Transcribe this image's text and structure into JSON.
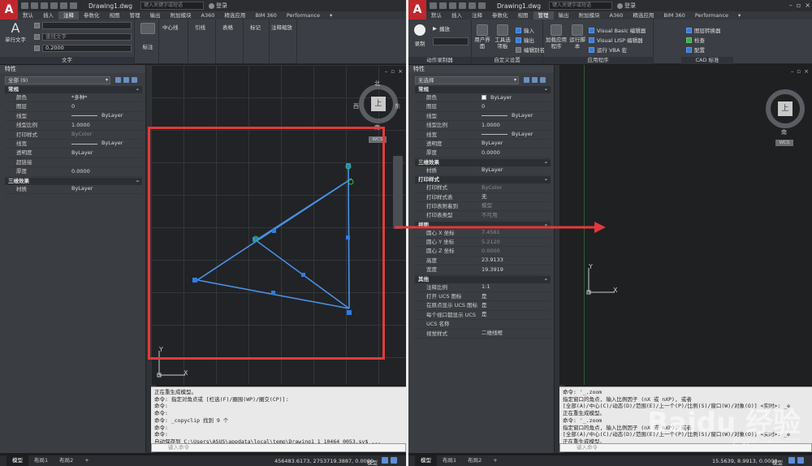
{
  "left": {
    "doc_title": "Drawing1.dwg",
    "search_placeholder": "键入关键字或短语",
    "login": "登录",
    "tabs": [
      "默认",
      "插入",
      "注释",
      "参数化",
      "视图",
      "管理",
      "输出",
      "附加模块",
      "A360",
      "精选应用",
      "BIM 360",
      "Performance"
    ],
    "active_tab": "注释",
    "ribbon": {
      "text_btn": "单行文字",
      "text_style_value": "",
      "text_find_placeholder": "查找文字",
      "text_height": "0.2000",
      "group_text": "文字",
      "dim_btn": "标注",
      "centerline": "中心线",
      "leader": "引线",
      "table": "表格",
      "markup": "标记",
      "anno_scale": "注释缩放"
    },
    "props": {
      "title": "特性",
      "selector": "全部 (9)",
      "sec_general": "常规",
      "rows": [
        {
          "k": "颜色",
          "v": "*多种*"
        },
        {
          "k": "图层",
          "v": "0"
        },
        {
          "k": "线型",
          "v": "ByLayer"
        },
        {
          "k": "线型比例",
          "v": "1.0000"
        },
        {
          "k": "打印样式",
          "v": "ByColor"
        },
        {
          "k": "线宽",
          "v": "ByLayer"
        },
        {
          "k": "透明度",
          "v": "ByLayer"
        },
        {
          "k": "超链接",
          "v": ""
        },
        {
          "k": "厚度",
          "v": "0.0000"
        }
      ],
      "sec_3d": "三维效果",
      "rows3d": [
        {
          "k": "材质",
          "v": "ByLayer"
        }
      ]
    },
    "viewcube": {
      "n": "北",
      "s": "南",
      "e": "东",
      "w": "西",
      "top": "上",
      "wcs": "WCS"
    },
    "ucs": {
      "x": "X",
      "y": "Y"
    },
    "cmd_lines": [
      "正在重生成模型。",
      "命令: 指定对角点或 [栏选(F)/圈围(WP)/圈交(CP)]:",
      "命令:",
      "命令:",
      "命令: _copyclip 找到 9 个",
      "命令:",
      "命令:",
      "自动保存到 C:\\Users\\ASUS\\appdata\\local\\temp\\Drawing1_1_10464_0053.sv$ ...",
      "命令:"
    ],
    "cmd_placeholder": "键入命令",
    "status_tabs": [
      "模型",
      "布局1",
      "布局2"
    ],
    "coords": "456483.6173, 2753719.3887, 0.0000",
    "model_label": "模型"
  },
  "right": {
    "doc_title": "Drawing1.dwg",
    "search_placeholder": "键入关键字或短语",
    "login": "登录",
    "tabs": [
      "默认",
      "插入",
      "注释",
      "参数化",
      "视图",
      "管理",
      "输出",
      "附加模块",
      "A360",
      "精选应用",
      "BIM 360",
      "Performance"
    ],
    "active_tab": "管理",
    "ribbon": {
      "record": "录制",
      "play": "播放",
      "group_action": "动作录制器",
      "user_interface": "用户界面",
      "tool_palettes": "工具选项板",
      "import": "输入",
      "export": "输出",
      "edit_alias": "编辑别名",
      "group_custom": "自定义设置",
      "load_app": "加载应用程序",
      "run_script": "运行脚本",
      "vb_editor": "Visual Basic 编辑器",
      "vlisp_editor": "Visual LISP 编辑器",
      "run_vba": "运行 VBA 宏",
      "group_app": "应用程序",
      "layer_translator": "图层转换器",
      "check": "检查",
      "configure": "配置",
      "group_cad": "CAD 标准"
    },
    "props": {
      "title": "特性",
      "selector": "无选择",
      "sec_general": "常规",
      "rows": [
        {
          "k": "颜色",
          "v": "ByLayer"
        },
        {
          "k": "图层",
          "v": "0"
        },
        {
          "k": "线型",
          "v": "ByLayer"
        },
        {
          "k": "线型比例",
          "v": "1.0000"
        },
        {
          "k": "线宽",
          "v": "ByLayer"
        },
        {
          "k": "透明度",
          "v": "ByLayer"
        },
        {
          "k": "厚度",
          "v": "0.0000"
        }
      ],
      "sec_3d": "三维效果",
      "rows3d": [
        {
          "k": "材质",
          "v": "ByLayer"
        }
      ],
      "sec_plot": "打印样式",
      "rows_plot": [
        {
          "k": "打印样式",
          "v": "ByColor"
        },
        {
          "k": "打印样式表",
          "v": "无"
        },
        {
          "k": "打印表附着到",
          "v": "模型"
        },
        {
          "k": "打印表类型",
          "v": "不可用"
        }
      ],
      "sec_view": "视图",
      "rows_view": [
        {
          "k": "圆心 X 坐标",
          "v": "7.4561"
        },
        {
          "k": "圆心 Y 坐标",
          "v": "5.2120"
        },
        {
          "k": "圆心 Z 坐标",
          "v": "0.0000"
        },
        {
          "k": "高度",
          "v": "23.9133"
        },
        {
          "k": "宽度",
          "v": "19.3919"
        }
      ],
      "sec_misc": "其他",
      "rows_misc": [
        {
          "k": "注释比例",
          "v": "1:1"
        },
        {
          "k": "打开 UCS 图标",
          "v": "是"
        },
        {
          "k": "在原点显示 UCS 图标",
          "v": "是"
        },
        {
          "k": "每个视口都显示 UCS",
          "v": "是"
        },
        {
          "k": "UCS 名称",
          "v": ""
        },
        {
          "k": "视觉样式",
          "v": "二维线框"
        }
      ]
    },
    "viewcube": {
      "s": "南",
      "top": "上",
      "wcs": "WCS"
    },
    "ucs": {
      "x": "X",
      "y": "Y"
    },
    "cmd_lines": [
      "命令: '_.zoom",
      "指定窗口的角点, 输入比例因子 (nX 或 nXP), 或者",
      "[全部(A)/中心(C)/动态(D)/范围(E)/上一个(P)/比例(S)/窗口(W)/对象(O)] <实时>: _e",
      "正在重生成模型。",
      "命令: '_.zoom",
      "指定窗口的角点, 输入比例因子 (nX 或 nXP), 或者",
      "[全部(A)/中心(C)/动态(D)/范围(E)/上一个(P)/比例(S)/窗口(W)/对象(O)] <实时>: _e",
      "正在重生成模型。"
    ],
    "cmd_placeholder": "键入命令",
    "status_tabs": [
      "模型",
      "布局1",
      "布局2"
    ],
    "coords": "15.5639, 8.9913, 0.0000",
    "model_label": "模型"
  },
  "watermark": {
    "brand": "Baidu 经验",
    "url": "jingyan.baidu.com"
  },
  "colors": {
    "highlight": "#e23a3a",
    "geometry": "#4a90e2",
    "grip": "#2f7de1"
  }
}
